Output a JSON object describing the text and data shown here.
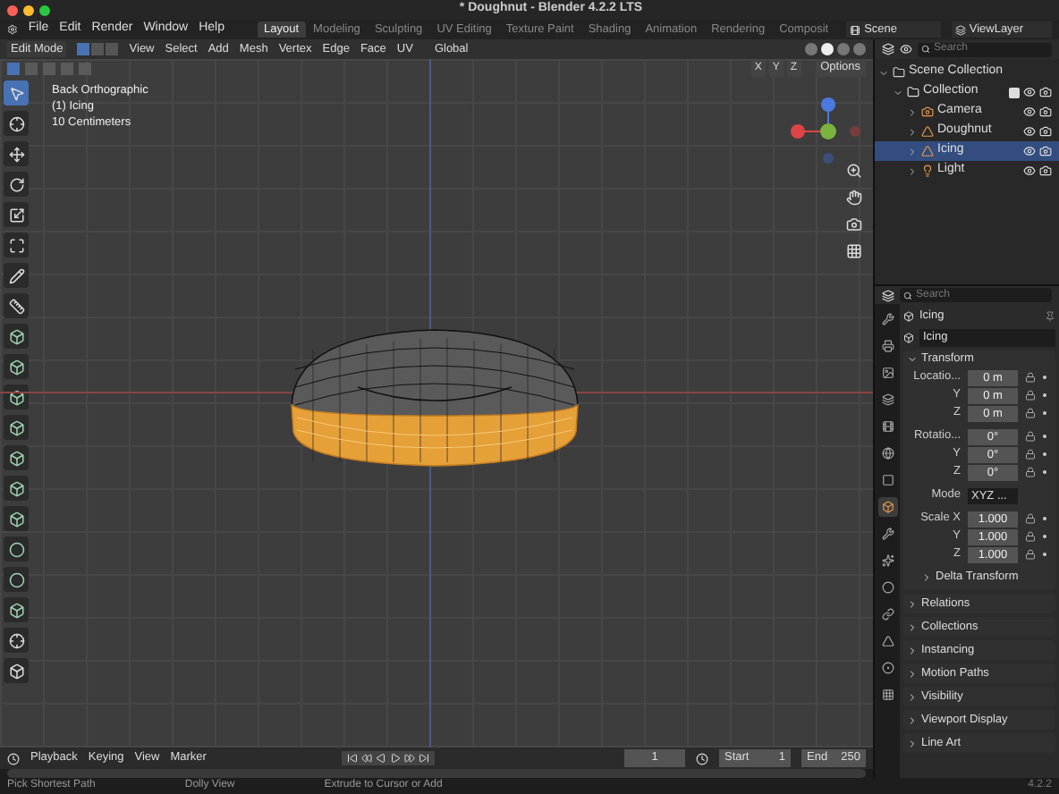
{
  "window": {
    "title": "* Doughnut - Blender 4.2.2 LTS"
  },
  "menu": [
    "File",
    "Edit",
    "Render",
    "Window",
    "Help"
  ],
  "workspaces": [
    {
      "label": "Layout",
      "selected": true
    },
    {
      "label": "Modeling",
      "selected": false
    },
    {
      "label": "Sculpting",
      "selected": false
    },
    {
      "label": "UV Editing",
      "selected": false
    },
    {
      "label": "Texture Paint",
      "selected": false
    },
    {
      "label": "Shading",
      "selected": false
    },
    {
      "label": "Animation",
      "selected": false
    },
    {
      "label": "Rendering",
      "selected": false
    },
    {
      "label": "Composit",
      "selected": false
    }
  ],
  "scene": "Scene",
  "view_layer": "ViewLayer",
  "header": {
    "mode": "Edit Mode",
    "menus": [
      "View",
      "Select",
      "Add",
      "Mesh",
      "Vertex",
      "Edge",
      "Face",
      "UV"
    ],
    "orientation": "Global",
    "mirror_axes": [
      "X",
      "Y",
      "Z"
    ],
    "options": "Options"
  },
  "select_modes": [
    {
      "selected": true
    },
    {
      "selected": false
    },
    {
      "selected": false
    }
  ],
  "shading_modes": [
    {
      "selected": false
    },
    {
      "selected": true
    },
    {
      "selected": false
    },
    {
      "selected": false
    }
  ],
  "viewport": {
    "overlay": [
      "Back Orthographic",
      "(1) Icing",
      "10 Centimeters"
    ]
  },
  "tools": [
    {
      "selected": true
    },
    {
      "selected": false
    },
    {
      "selected": false
    },
    {
      "selected": false
    },
    {
      "selected": false
    },
    {
      "selected": false
    },
    {
      "selected": false
    },
    {
      "selected": false
    },
    {
      "selected": false
    },
    {
      "selected": false
    },
    {
      "selected": false
    },
    {
      "selected": false
    },
    {
      "selected": false
    },
    {
      "selected": false
    },
    {
      "selected": false
    },
    {
      "selected": false
    },
    {
      "selected": false
    },
    {
      "selected": false
    },
    {
      "selected": false
    },
    {
      "selected": false
    }
  ],
  "outliner": {
    "search": {
      "placeholder": "Search"
    },
    "items": [
      {
        "label": "Scene Collection",
        "kind": "scene",
        "selected": false,
        "expanded": true,
        "children": [
          {
            "label": "Collection",
            "kind": "collection",
            "selected": false,
            "expanded": true,
            "checked": true,
            "children": [
              {
                "label": "Camera",
                "kind": "camera",
                "selected": false,
                "expanded": false
              },
              {
                "label": "Doughnut",
                "kind": "mesh",
                "selected": false,
                "expanded": false
              },
              {
                "label": "Icing",
                "kind": "mesh",
                "selected": true,
                "expanded": false
              },
              {
                "label": "Light",
                "kind": "light",
                "selected": false,
                "expanded": false
              }
            ]
          }
        ]
      }
    ]
  },
  "properties": {
    "search": {
      "placeholder": "Search"
    },
    "object": "Icing",
    "data_name": "Icing",
    "tabs": [
      {
        "selected": false
      },
      {
        "selected": false
      },
      {
        "selected": false
      },
      {
        "selected": false
      },
      {
        "selected": false
      },
      {
        "selected": false
      },
      {
        "selected": false
      },
      {
        "selected": true
      },
      {
        "selected": false
      },
      {
        "selected": false
      },
      {
        "selected": false
      },
      {
        "selected": false
      },
      {
        "selected": false
      },
      {
        "selected": false
      },
      {
        "selected": false
      }
    ],
    "transform": {
      "title": "Transform",
      "expanded": true,
      "location": [
        {
          "label": "Locatio...",
          "value": "0 m"
        },
        {
          "label": "Y",
          "value": "0 m"
        },
        {
          "label": "Z",
          "value": "0 m"
        }
      ],
      "rotation": [
        {
          "label": "Rotatio...",
          "value": "0°"
        },
        {
          "label": "Y",
          "value": "0°"
        },
        {
          "label": "Z",
          "value": "0°"
        }
      ],
      "mode": {
        "label": "Mode",
        "value": "XYZ ..."
      },
      "scale": [
        {
          "label": "Scale X",
          "value": "1.000"
        },
        {
          "label": "Y",
          "value": "1.000"
        },
        {
          "label": "Z",
          "value": "1.000"
        }
      ],
      "delta": {
        "title": "Delta Transform",
        "expanded": false
      }
    },
    "sections": [
      {
        "title": "Relations",
        "expanded": false
      },
      {
        "title": "Collections",
        "expanded": false
      },
      {
        "title": "Instancing",
        "expanded": false
      },
      {
        "title": "Motion Paths",
        "expanded": false
      },
      {
        "title": "Visibility",
        "expanded": false
      },
      {
        "title": "Viewport Display",
        "expanded": false
      },
      {
        "title": "Line Art",
        "expanded": false
      }
    ]
  },
  "timeline": {
    "menus": [
      "Playback",
      "Keying",
      "View",
      "Marker"
    ],
    "frame": "1",
    "start_label": "Start",
    "start": "1",
    "end_label": "End",
    "end": "250"
  },
  "status_bar": {
    "items": [
      "Pick Shortest Path",
      "Dolly View",
      "Extrude to Cursor or Add"
    ],
    "version": "4.2.2"
  }
}
